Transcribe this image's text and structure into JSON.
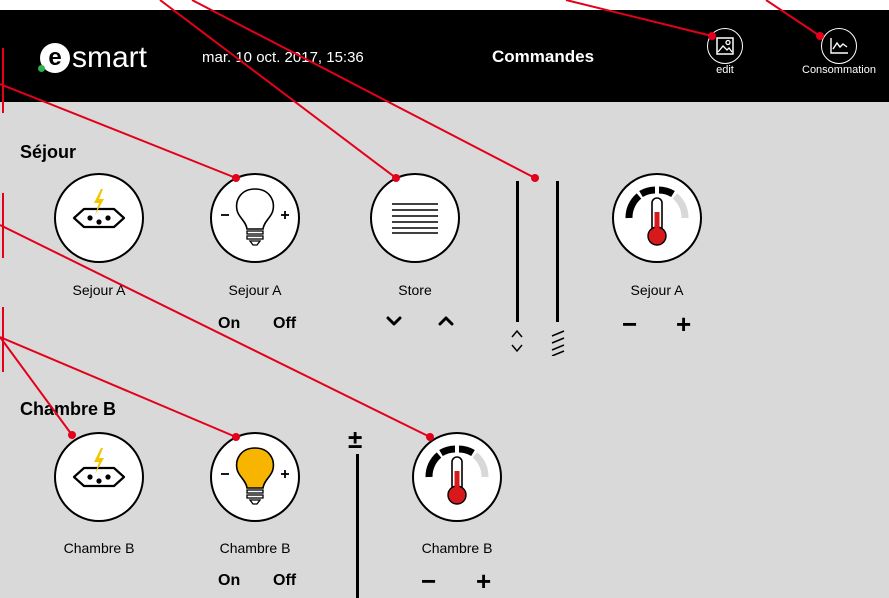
{
  "header": {
    "logo_text": "smart",
    "logo_letter": "e",
    "datetime": "mar. 10 oct. 2017, 15:36",
    "title": "Commandes",
    "edit_label": "edit",
    "consumption_label": "Consommation"
  },
  "sections": [
    {
      "title": "Séjour",
      "devices": [
        {
          "label": "Sejour A",
          "type": "socket"
        },
        {
          "label": "Sejour A",
          "type": "light",
          "state": "off",
          "on_label": "On",
          "off_label": "Off"
        },
        {
          "label": "Store",
          "type": "blind",
          "down_symbol": "⌄",
          "up_symbol": "⌃"
        },
        {
          "label": "Sejour A",
          "type": "thermostat",
          "minus": "−",
          "plus": "+"
        }
      ]
    },
    {
      "title": "Chambre B",
      "devices": [
        {
          "label": "Chambre B",
          "type": "socket"
        },
        {
          "label": "Chambre B",
          "type": "light",
          "state": "on",
          "on_label": "On",
          "off_label": "Off"
        },
        {
          "label": "Chambre B",
          "type": "thermostat",
          "minus": "−",
          "plus": "+"
        }
      ],
      "slider_symbol": "±"
    }
  ],
  "colors": {
    "header_bg": "#000000",
    "page_bg": "#d9d9d9",
    "accent_green": "#2bb24c",
    "lightning": "#f2c500",
    "bulb_on": "#f7b500",
    "thermo_red": "#d7191c",
    "annotation_red": "#e3001b"
  }
}
